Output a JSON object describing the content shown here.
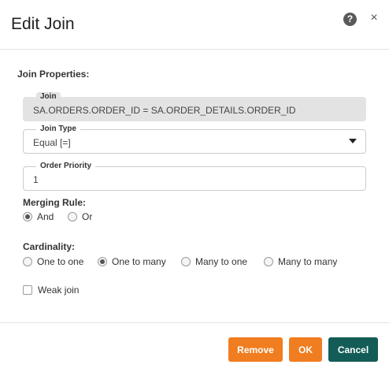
{
  "dialog": {
    "title": "Edit Join",
    "help_glyph": "?",
    "close_glyph": "×"
  },
  "section_title": "Join Properties:",
  "join": {
    "legend": "Join",
    "value": "SA.ORDERS.ORDER_ID = SA.ORDER_DETAILS.ORDER_ID"
  },
  "join_type": {
    "legend": "Join Type",
    "selected": "Equal [=]"
  },
  "order_priority": {
    "legend": "Order Priority",
    "value": "1"
  },
  "merging_rule": {
    "label": "Merging Rule:",
    "options": [
      {
        "label": "And",
        "checked": true
      },
      {
        "label": "Or",
        "checked": false
      }
    ]
  },
  "cardinality": {
    "label": "Cardinality:",
    "options": [
      {
        "label": "One to one",
        "checked": false
      },
      {
        "label": "One to many",
        "checked": true
      },
      {
        "label": "Many to one",
        "checked": false
      },
      {
        "label": "Many to many",
        "checked": false
      }
    ]
  },
  "weak_join": {
    "label": "Weak join",
    "checked": false
  },
  "buttons": {
    "remove": "Remove",
    "ok": "OK",
    "cancel": "Cancel"
  },
  "colors": {
    "remove_bg": "#f07d1f",
    "ok_bg": "#f07d1f",
    "cancel_bg": "#145c57"
  }
}
